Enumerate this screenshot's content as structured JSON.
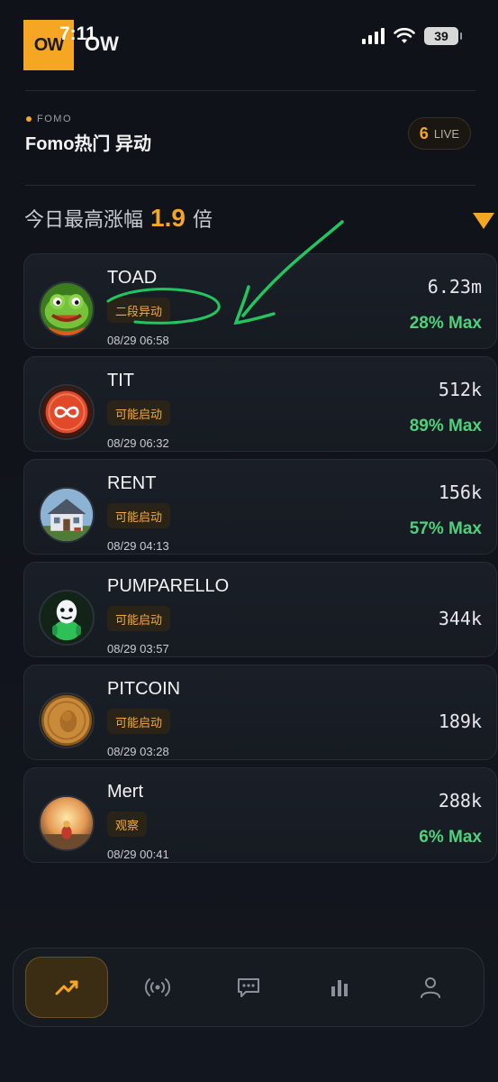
{
  "status_bar": {
    "logo_text": "OW",
    "logo_label": "OW",
    "time": "7:11",
    "battery": "39"
  },
  "header": {
    "tag": "FOMO",
    "title": "Fomo热门 异动",
    "live_count": "6",
    "live_label": "LIVE"
  },
  "summary": {
    "prefix": "今日最高涨幅",
    "multiplier": "1.9",
    "suffix": "倍"
  },
  "tokens": [
    {
      "name": "TOAD",
      "tag": "二段异动",
      "time": "08/29 06:58",
      "mcap": "6.23m",
      "max": "28% Max",
      "avatar": "frog-avatar-icon"
    },
    {
      "name": "TIT",
      "tag": "可能启动",
      "time": "08/29 06:32",
      "mcap": "512k",
      "max": "89% Max",
      "avatar": "infinity-coin-icon"
    },
    {
      "name": "RENT",
      "tag": "可能启动",
      "time": "08/29 04:13",
      "mcap": "156k",
      "max": "57% Max",
      "avatar": "house-icon"
    },
    {
      "name": "PUMPARELLO",
      "tag": "可能启动",
      "time": "08/29 03:57",
      "mcap": "344k",
      "max": "",
      "avatar": "mascot-icon"
    },
    {
      "name": "PITCOIN",
      "tag": "可能启动",
      "time": "08/29 03:28",
      "mcap": "189k",
      "max": "",
      "avatar": "gold-coin-icon"
    },
    {
      "name": "Mert",
      "tag": "观察",
      "time": "08/29 00:41",
      "mcap": "288k",
      "max": "6% Max",
      "avatar": "sunset-icon"
    }
  ],
  "tabbar": {
    "tabs": [
      "trending-icon",
      "broadcast-icon",
      "chat-icon",
      "chart-icon",
      "profile-icon"
    ],
    "active_index": 0
  },
  "colors": {
    "accent": "#f5a623",
    "positive": "#4ed17a",
    "background": "#10131a",
    "card": "#1a1f27",
    "annotation": "#22c55e"
  }
}
